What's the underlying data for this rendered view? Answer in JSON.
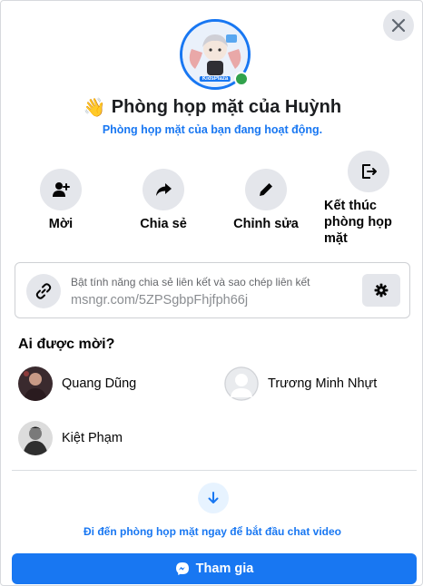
{
  "header": {
    "close_icon": "close-icon",
    "avatar_caption": "KidsPlaza",
    "title_emoji": "👋",
    "title": "Phòng họp mặt của Huỳnh",
    "subtitle": "Phòng họp mặt của bạn đang hoạt động."
  },
  "actions": [
    {
      "label": "Mời",
      "icon": "add-person-icon"
    },
    {
      "label": "Chia sẻ",
      "icon": "share-arrow-icon"
    },
    {
      "label": "Chỉnh sửa",
      "icon": "pencil-icon"
    },
    {
      "label": "Kết thúc phòng họp mặt",
      "icon": "exit-icon"
    }
  ],
  "link": {
    "hint": "Bật tính năng chia sẻ liên kết và sao chép liên kết",
    "url": "msngr.com/5ZPSgbpFhjfph66j",
    "link_icon": "link-icon",
    "settings_icon": "gear-icon"
  },
  "invited": {
    "heading": "Ai được mời?",
    "people": [
      {
        "name": "Quang Dũng"
      },
      {
        "name": "Trương Minh Nhựt"
      },
      {
        "name": "Kiệt Phạm"
      }
    ]
  },
  "footer": {
    "down_icon": "arrow-down-icon",
    "go_text": "Đi đến phòng họp mặt ngay để bắt đầu chat video",
    "join_label": "Tham gia",
    "join_icon": "messenger-icon"
  },
  "colors": {
    "accent": "#1877f2",
    "online": "#31a24c",
    "button_bg": "#e4e6eb"
  }
}
